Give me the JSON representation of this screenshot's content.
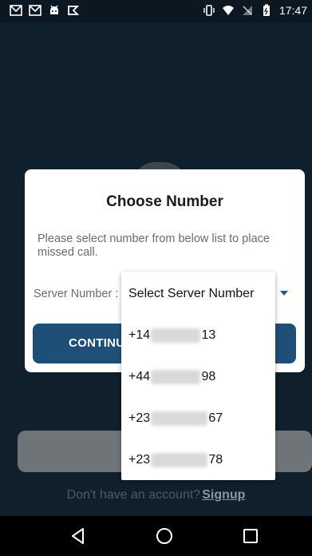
{
  "status_bar": {
    "time": "17:47",
    "left_icons": [
      "mail-icon",
      "mail-icon",
      "android-icon",
      "flag-icon"
    ],
    "right_icons": [
      "vibrate-icon",
      "wifi-icon",
      "no-signal-icon",
      "battery-icon"
    ]
  },
  "dialog": {
    "title": "Choose Number",
    "description": "Please select number from below list to place missed call.",
    "server_label": "Server Number :",
    "continue_label": "CONTINU"
  },
  "dropdown": {
    "header": "Select Server Number",
    "options": [
      {
        "prefix": "+14",
        "masked": "8342915",
        "suffix": "13"
      },
      {
        "prefix": "+44",
        "masked": "7447996",
        "suffix": "98"
      },
      {
        "prefix": "+23",
        "masked": "49060000",
        "suffix": "67"
      },
      {
        "prefix": "+23",
        "masked": "49060000",
        "suffix": "78"
      }
    ]
  },
  "footer": {
    "prompt": "Don't have an account?",
    "signup_label": "Signup"
  },
  "nav": {
    "icons": [
      "back-icon",
      "home-icon",
      "recents-icon"
    ]
  },
  "colors": {
    "background": "#0f1f2b",
    "primary": "#1f4f77",
    "dropdown_arrow": "#1f5a8c"
  }
}
